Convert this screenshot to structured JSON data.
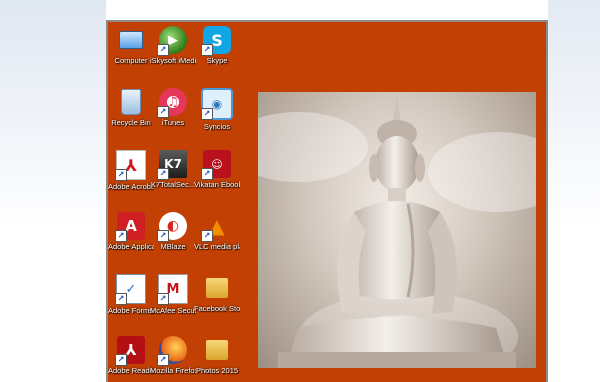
{
  "desktop": {
    "background_color": "#c24003",
    "icons": [
      {
        "label": "Computer",
        "icon": "computer-icon"
      },
      {
        "label": "iSkysoft iMedia ...",
        "icon": "iskysoft-icon"
      },
      {
        "label": "Skype",
        "icon": "skype-icon"
      },
      {
        "label": "Recycle Bin",
        "icon": "recycle-bin-icon"
      },
      {
        "label": "iTunes",
        "icon": "itunes-icon"
      },
      {
        "label": "Syncios",
        "icon": "syncios-icon"
      },
      {
        "label": "Adobe Acrobat...",
        "icon": "adobe-acrobat-icon"
      },
      {
        "label": "K7TotalSec...",
        "icon": "k7-icon"
      },
      {
        "label": "Vikatan Ebooks",
        "icon": "vikatan-icon"
      },
      {
        "label": "Adobe Applicati...",
        "icon": "adobe-application-icon"
      },
      {
        "label": "MBlaze",
        "icon": "mblaze-icon"
      },
      {
        "label": "VLC media player",
        "icon": "vlc-icon"
      },
      {
        "label": "Adobe FormsCentral",
        "icon": "forms-central-icon"
      },
      {
        "label": "McAfee Security Sc...",
        "icon": "mcafee-icon"
      },
      {
        "label": "Facebook Stories 2015",
        "icon": "folder-icon"
      },
      {
        "label": "Adobe Reader 8",
        "icon": "adobe-reader-icon"
      },
      {
        "label": "Mozilla Firefox",
        "icon": "firefox-icon"
      },
      {
        "label": "Photos 2015",
        "icon": "folder-icon"
      }
    ],
    "wallpaper": {
      "subject": "buddha-statue"
    }
  }
}
